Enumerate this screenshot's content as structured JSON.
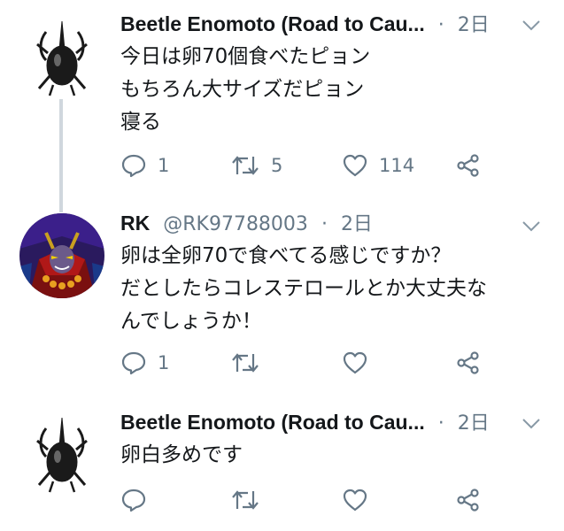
{
  "tweets": [
    {
      "name": "Beetle Enomoto (Road to Cau...",
      "handle": "",
      "time": "2日",
      "text": "今日は卵70個食べたピョン\nもちろん大サイズだピョン\n寝る",
      "reply_count": "1",
      "retweet_count": "5",
      "like_count": "114",
      "avatar": "beetle-icon"
    },
    {
      "name": "RK",
      "handle": "@RK97788003",
      "time": "2日",
      "text": "卵は全卵70で食べてる感じですか？\nだとしたらコレステロールとか大丈夫な\nんでしょうか！",
      "reply_count": "1",
      "retweet_count": "",
      "like_count": "",
      "avatar": "villain-icon"
    },
    {
      "name": "Beetle Enomoto (Road to Cau...",
      "handle": "",
      "time": "2日",
      "text": "卵白多めです",
      "reply_count": "",
      "retweet_count": "",
      "like_count": "",
      "avatar": "beetle-icon"
    }
  ],
  "separator": "·",
  "colors": {
    "text": "#14171a",
    "muted": "#657786",
    "thread_line": "#d0d7dd"
  }
}
